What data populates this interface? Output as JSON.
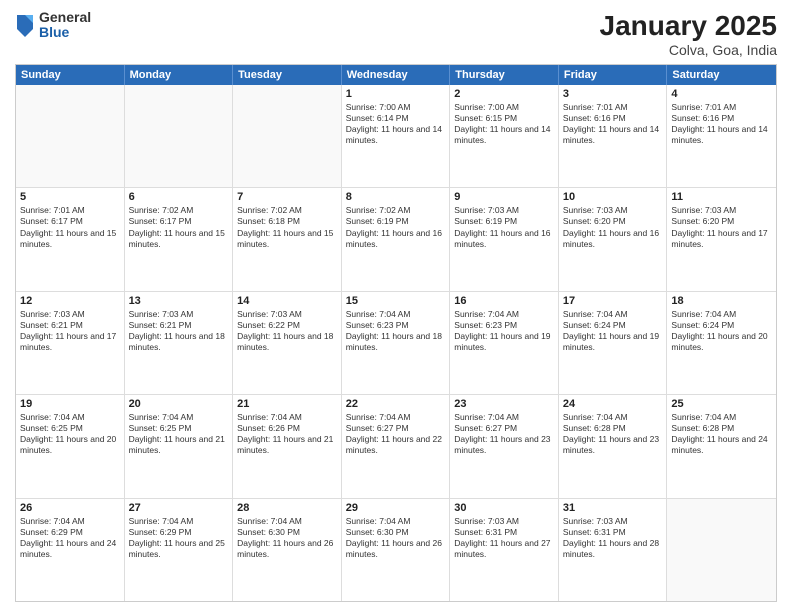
{
  "header": {
    "logo": {
      "general": "General",
      "blue": "Blue"
    },
    "title": "January 2025",
    "subtitle": "Colva, Goa, India"
  },
  "days": [
    "Sunday",
    "Monday",
    "Tuesday",
    "Wednesday",
    "Thursday",
    "Friday",
    "Saturday"
  ],
  "rows": [
    [
      {
        "day": "",
        "empty": true
      },
      {
        "day": "",
        "empty": true
      },
      {
        "day": "",
        "empty": true
      },
      {
        "day": "1",
        "sunrise": "Sunrise: 7:00 AM",
        "sunset": "Sunset: 6:14 PM",
        "daylight": "Daylight: 11 hours and 14 minutes."
      },
      {
        "day": "2",
        "sunrise": "Sunrise: 7:00 AM",
        "sunset": "Sunset: 6:15 PM",
        "daylight": "Daylight: 11 hours and 14 minutes."
      },
      {
        "day": "3",
        "sunrise": "Sunrise: 7:01 AM",
        "sunset": "Sunset: 6:16 PM",
        "daylight": "Daylight: 11 hours and 14 minutes."
      },
      {
        "day": "4",
        "sunrise": "Sunrise: 7:01 AM",
        "sunset": "Sunset: 6:16 PM",
        "daylight": "Daylight: 11 hours and 14 minutes."
      }
    ],
    [
      {
        "day": "5",
        "sunrise": "Sunrise: 7:01 AM",
        "sunset": "Sunset: 6:17 PM",
        "daylight": "Daylight: 11 hours and 15 minutes."
      },
      {
        "day": "6",
        "sunrise": "Sunrise: 7:02 AM",
        "sunset": "Sunset: 6:17 PM",
        "daylight": "Daylight: 11 hours and 15 minutes."
      },
      {
        "day": "7",
        "sunrise": "Sunrise: 7:02 AM",
        "sunset": "Sunset: 6:18 PM",
        "daylight": "Daylight: 11 hours and 15 minutes."
      },
      {
        "day": "8",
        "sunrise": "Sunrise: 7:02 AM",
        "sunset": "Sunset: 6:19 PM",
        "daylight": "Daylight: 11 hours and 16 minutes."
      },
      {
        "day": "9",
        "sunrise": "Sunrise: 7:03 AM",
        "sunset": "Sunset: 6:19 PM",
        "daylight": "Daylight: 11 hours and 16 minutes."
      },
      {
        "day": "10",
        "sunrise": "Sunrise: 7:03 AM",
        "sunset": "Sunset: 6:20 PM",
        "daylight": "Daylight: 11 hours and 16 minutes."
      },
      {
        "day": "11",
        "sunrise": "Sunrise: 7:03 AM",
        "sunset": "Sunset: 6:20 PM",
        "daylight": "Daylight: 11 hours and 17 minutes."
      }
    ],
    [
      {
        "day": "12",
        "sunrise": "Sunrise: 7:03 AM",
        "sunset": "Sunset: 6:21 PM",
        "daylight": "Daylight: 11 hours and 17 minutes."
      },
      {
        "day": "13",
        "sunrise": "Sunrise: 7:03 AM",
        "sunset": "Sunset: 6:21 PM",
        "daylight": "Daylight: 11 hours and 18 minutes."
      },
      {
        "day": "14",
        "sunrise": "Sunrise: 7:03 AM",
        "sunset": "Sunset: 6:22 PM",
        "daylight": "Daylight: 11 hours and 18 minutes."
      },
      {
        "day": "15",
        "sunrise": "Sunrise: 7:04 AM",
        "sunset": "Sunset: 6:23 PM",
        "daylight": "Daylight: 11 hours and 18 minutes."
      },
      {
        "day": "16",
        "sunrise": "Sunrise: 7:04 AM",
        "sunset": "Sunset: 6:23 PM",
        "daylight": "Daylight: 11 hours and 19 minutes."
      },
      {
        "day": "17",
        "sunrise": "Sunrise: 7:04 AM",
        "sunset": "Sunset: 6:24 PM",
        "daylight": "Daylight: 11 hours and 19 minutes."
      },
      {
        "day": "18",
        "sunrise": "Sunrise: 7:04 AM",
        "sunset": "Sunset: 6:24 PM",
        "daylight": "Daylight: 11 hours and 20 minutes."
      }
    ],
    [
      {
        "day": "19",
        "sunrise": "Sunrise: 7:04 AM",
        "sunset": "Sunset: 6:25 PM",
        "daylight": "Daylight: 11 hours and 20 minutes."
      },
      {
        "day": "20",
        "sunrise": "Sunrise: 7:04 AM",
        "sunset": "Sunset: 6:25 PM",
        "daylight": "Daylight: 11 hours and 21 minutes."
      },
      {
        "day": "21",
        "sunrise": "Sunrise: 7:04 AM",
        "sunset": "Sunset: 6:26 PM",
        "daylight": "Daylight: 11 hours and 21 minutes."
      },
      {
        "day": "22",
        "sunrise": "Sunrise: 7:04 AM",
        "sunset": "Sunset: 6:27 PM",
        "daylight": "Daylight: 11 hours and 22 minutes."
      },
      {
        "day": "23",
        "sunrise": "Sunrise: 7:04 AM",
        "sunset": "Sunset: 6:27 PM",
        "daylight": "Daylight: 11 hours and 23 minutes."
      },
      {
        "day": "24",
        "sunrise": "Sunrise: 7:04 AM",
        "sunset": "Sunset: 6:28 PM",
        "daylight": "Daylight: 11 hours and 23 minutes."
      },
      {
        "day": "25",
        "sunrise": "Sunrise: 7:04 AM",
        "sunset": "Sunset: 6:28 PM",
        "daylight": "Daylight: 11 hours and 24 minutes."
      }
    ],
    [
      {
        "day": "26",
        "sunrise": "Sunrise: 7:04 AM",
        "sunset": "Sunset: 6:29 PM",
        "daylight": "Daylight: 11 hours and 24 minutes."
      },
      {
        "day": "27",
        "sunrise": "Sunrise: 7:04 AM",
        "sunset": "Sunset: 6:29 PM",
        "daylight": "Daylight: 11 hours and 25 minutes."
      },
      {
        "day": "28",
        "sunrise": "Sunrise: 7:04 AM",
        "sunset": "Sunset: 6:30 PM",
        "daylight": "Daylight: 11 hours and 26 minutes."
      },
      {
        "day": "29",
        "sunrise": "Sunrise: 7:04 AM",
        "sunset": "Sunset: 6:30 PM",
        "daylight": "Daylight: 11 hours and 26 minutes."
      },
      {
        "day": "30",
        "sunrise": "Sunrise: 7:03 AM",
        "sunset": "Sunset: 6:31 PM",
        "daylight": "Daylight: 11 hours and 27 minutes."
      },
      {
        "day": "31",
        "sunrise": "Sunrise: 7:03 AM",
        "sunset": "Sunset: 6:31 PM",
        "daylight": "Daylight: 11 hours and 28 minutes."
      },
      {
        "day": "",
        "empty": true
      }
    ]
  ]
}
